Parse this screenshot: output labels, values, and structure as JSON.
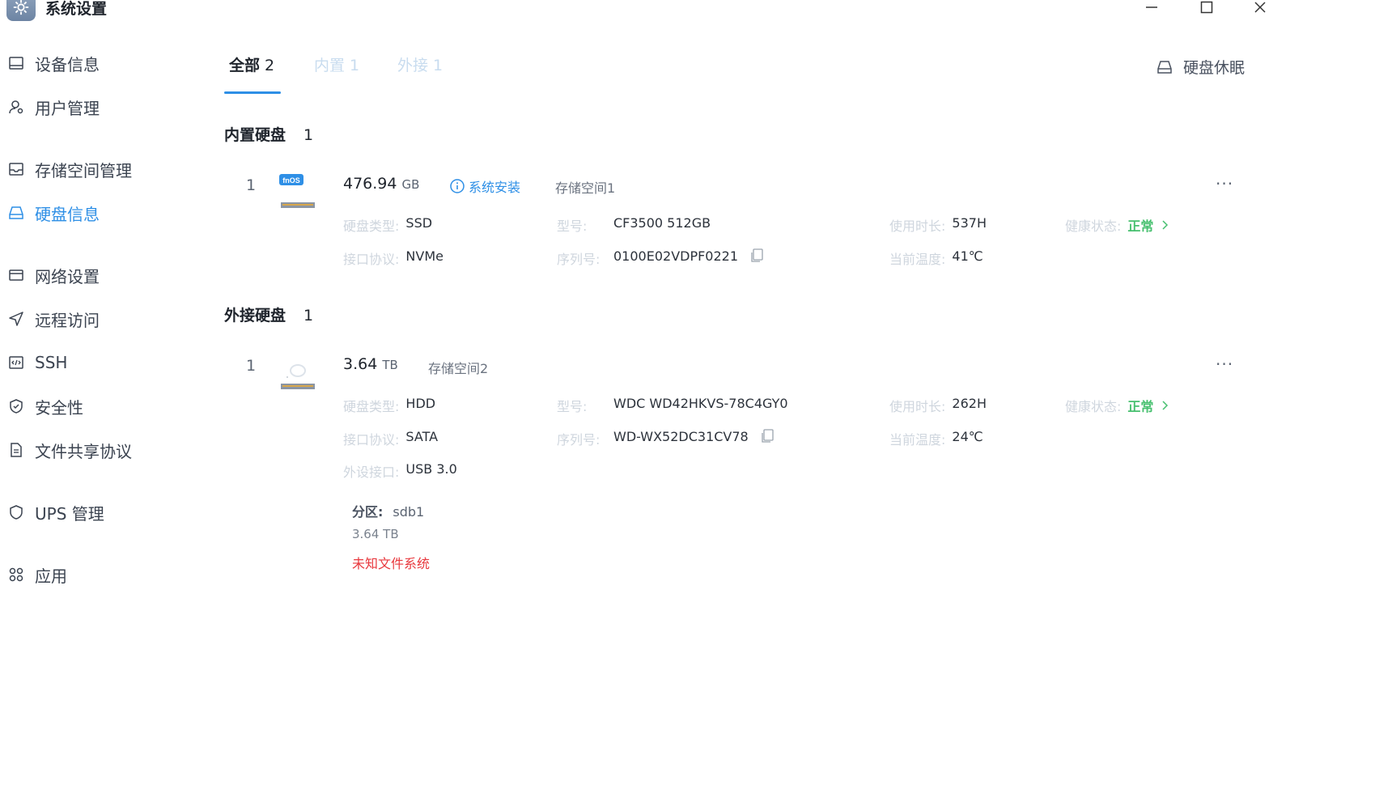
{
  "window": {
    "title": "系统设置"
  },
  "sidebar": {
    "items": [
      {
        "label": "设备信息",
        "icon": "monitor-icon"
      },
      {
        "label": "用户管理",
        "icon": "user-gear-icon"
      },
      {
        "label": "存储空间管理",
        "icon": "inbox-icon"
      },
      {
        "label": "硬盘信息",
        "icon": "hard-disk-icon",
        "active": true
      },
      {
        "label": "网络设置",
        "icon": "network-card-icon"
      },
      {
        "label": "远程访问",
        "icon": "send-icon"
      },
      {
        "label": "SSH",
        "icon": "code-window-icon"
      },
      {
        "label": "安全性",
        "icon": "shield-check-icon"
      },
      {
        "label": "文件共享协议",
        "icon": "document-icon"
      },
      {
        "label": "UPS 管理",
        "icon": "shield-icon"
      },
      {
        "label": "应用",
        "icon": "apps-grid-icon"
      }
    ]
  },
  "tabs": [
    {
      "label": "全部",
      "count": "2",
      "active": true
    },
    {
      "label": "内置",
      "count": "1"
    },
    {
      "label": "外接",
      "count": "1"
    }
  ],
  "actions": {
    "sleep_label": "硬盘休眠"
  },
  "internal": {
    "title": "内置硬盘",
    "count": "1",
    "disk": {
      "index": "1",
      "badge": "fnOS",
      "capacity": "476.94",
      "unit": "GB",
      "system_install": "系统安装",
      "pool": "存储空间1",
      "type_label": "硬盘类型:",
      "type": "SSD",
      "iface_label": "接口协议:",
      "iface": "NVMe",
      "model_label": "型号:",
      "model": "CF3500 512GB",
      "serial_label": "序列号:",
      "serial": "0100E02VDPF0221",
      "hours_label": "使用时长:",
      "hours": "537H",
      "temp_label": "当前温度:",
      "temp": "41℃",
      "health_label": "健康状态:",
      "health": "正常"
    }
  },
  "external": {
    "title": "外接硬盘",
    "count": "1",
    "disk": {
      "index": "1",
      "capacity": "3.64",
      "unit": "TB",
      "pool": "存储空间2",
      "type_label": "硬盘类型:",
      "type": "HDD",
      "iface_label": "接口协议:",
      "iface": "SATA",
      "port_label": "外设接口:",
      "port": "USB 3.0",
      "model_label": "型号:",
      "model": "WDC WD42HKVS-78C4GY0",
      "serial_label": "序列号:",
      "serial": "WD-WX52DC31CV78",
      "hours_label": "使用时长:",
      "hours": "262H",
      "temp_label": "当前温度:",
      "temp": "24℃",
      "health_label": "健康状态:",
      "health": "正常"
    },
    "partition": {
      "label": "分区:",
      "name": "sdb1",
      "size": "3.64 TB",
      "fs": "未知文件系统"
    }
  },
  "colors": {
    "accent": "#2e8fe6",
    "ok": "#47c06f",
    "error": "#e8383d"
  }
}
